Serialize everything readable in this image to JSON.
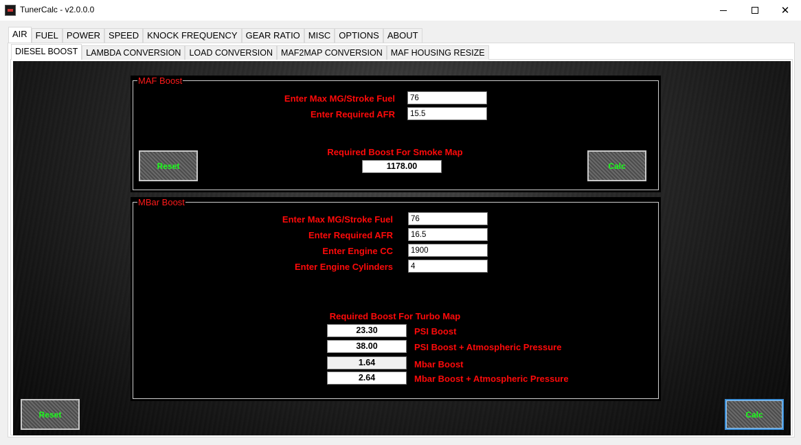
{
  "window": {
    "title": "TunerCalc - v2.0.0.0",
    "minimize": "—",
    "maximize": "□",
    "close": "✕"
  },
  "tabs": [
    "AIR",
    "FUEL",
    "POWER",
    "SPEED",
    "KNOCK FREQUENCY",
    "GEAR RATIO",
    "MISC",
    "OPTIONS",
    "ABOUT"
  ],
  "active_tab": "AIR",
  "subtabs": [
    "DIESEL BOOST",
    "LAMBDA CONVERSION",
    "LOAD CONVERSION",
    "MAF2MAP CONVERSION",
    "MAF HOUSING RESIZE"
  ],
  "active_subtab": "DIESEL BOOST",
  "maf_boost": {
    "legend": "MAF Boost",
    "fuel_label": "Enter Max MG/Stroke Fuel",
    "fuel_value": "76",
    "afr_label": "Enter Required AFR",
    "afr_value": "15.5",
    "result_label": "Required Boost For Smoke Map",
    "result_value": "1178.00",
    "reset_label": "Reset",
    "calc_label": "Calc"
  },
  "mbar_boost": {
    "legend": "MBar Boost",
    "fuel_label": "Enter Max MG/Stroke Fuel",
    "fuel_value": "76",
    "afr_label": "Enter Required AFR",
    "afr_value": "16.5",
    "cc_label": "Enter Engine CC",
    "cc_value": "1900",
    "cyl_label": "Enter Engine Cylinders",
    "cyl_value": "4",
    "result_title": "Required Boost For Turbo Map",
    "psi_value": "23.30",
    "psi_label": "PSI Boost",
    "psi_atm_value": "38.00",
    "psi_atm_label": "PSI Boost + Atmospheric Pressure",
    "mbar_value": "1.64",
    "mbar_label": "Mbar Boost",
    "mbar_atm_value": "2.64",
    "mbar_atm_label": "Mbar Boost + Atmospheric  Pressure"
  },
  "bottom": {
    "reset_label": "Reset",
    "calc_label": "Calc"
  },
  "colors": {
    "label": "#ff0a0a",
    "button_text": "#1aff1a",
    "background": "#141414"
  }
}
